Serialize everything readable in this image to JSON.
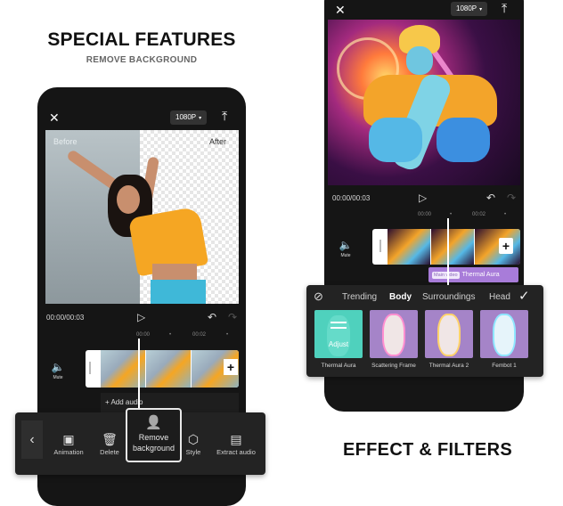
{
  "left_panel": {
    "title": "SPECIAL FEATURES",
    "subtitle": "REMOVE BACKGROUND",
    "top_bar": {
      "close_icon": "✕",
      "resolution": "1080P",
      "caret": "▾",
      "export_icon": "⤒"
    },
    "preview": {
      "before_label": "Before",
      "after_label": "After"
    },
    "controls": {
      "time": "00:00/00:03",
      "play_icon": "▷",
      "undo_icon": "↶",
      "redo_icon": "↷"
    },
    "ruler": [
      "00:00",
      "•",
      "00:02",
      "•"
    ],
    "timeline": {
      "mute_label": "Mute",
      "mute_icon": "🔈",
      "add_clip": "+",
      "add_audio": "+ Add audio"
    },
    "toolbar": {
      "back_icon": "‹",
      "items": [
        {
          "label": "Animation",
          "icon": "▣"
        },
        {
          "label": "Delete",
          "icon": "🗑"
        },
        {
          "label": "Style",
          "icon": "⬡"
        },
        {
          "label": "Extract audio",
          "icon": "▤"
        }
      ],
      "highlighted": {
        "label_line1": "Remove",
        "label_line2": "background",
        "icon": "👤"
      }
    }
  },
  "right_panel": {
    "title": "EFFECT & FILTERS",
    "top_bar": {
      "close_icon": "✕",
      "resolution": "1080P",
      "caret": "▾",
      "export_icon": "⤒"
    },
    "controls": {
      "time": "00:00/00:03",
      "play_icon": "▷",
      "undo_icon": "↶",
      "redo_icon": "↷"
    },
    "ruler": [
      "00:00",
      "•",
      "00:02",
      "•"
    ],
    "timeline": {
      "mute_label": "Mute",
      "mute_icon": "🔈",
      "add_clip": "+"
    },
    "effect_tag": {
      "badge": "Main video",
      "name": "Thermal Aura"
    },
    "filters": {
      "none_icon": "⊘",
      "confirm_icon": "✓",
      "tabs": [
        {
          "label": "Trending",
          "active": false
        },
        {
          "label": "Body",
          "active": true
        },
        {
          "label": "Surroundings",
          "active": false
        },
        {
          "label": "Head",
          "active": false
        }
      ],
      "adjust_label": "Adjust",
      "items": [
        "Thermal Aura",
        "Scattering Frame",
        "Thermal Aura 2",
        "Fembot 1"
      ]
    }
  },
  "colors": {
    "phone_bg": "#151515",
    "panel_bg": "#232323",
    "effect_tag": "#a87cd9",
    "adjust_card": "#4fd1bd"
  }
}
